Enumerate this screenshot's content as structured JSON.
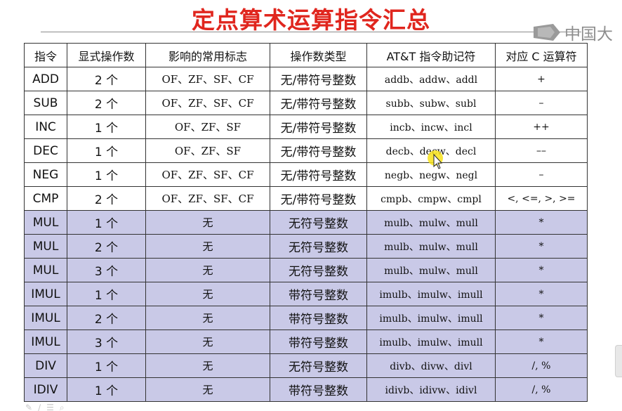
{
  "title": "定点算术运算指令汇总",
  "watermark": {
    "text": "中国大",
    "icon": "mooc-logo-icon"
  },
  "table": {
    "headers": [
      "指令",
      "显式操作数",
      "影响的常用标志",
      "操作数类型",
      "AT&T 指令助记符",
      "对应 C 运算符"
    ],
    "rows": [
      {
        "instr": "ADD",
        "operands": "2 个",
        "flags": "OF、ZF、SF、CF",
        "type": "无/带符号整数",
        "mnemonics": "addb、addw、addl",
        "c_op": "+",
        "group": "basic"
      },
      {
        "instr": "SUB",
        "operands": "2 个",
        "flags": "OF、ZF、SF、CF",
        "type": "无/带符号整数",
        "mnemonics": "subb、subw、subl",
        "c_op": "–",
        "group": "basic"
      },
      {
        "instr": "INC",
        "operands": "1 个",
        "flags": "OF、ZF、SF",
        "type": "无/带符号整数",
        "mnemonics": "incb、incw、incl",
        "c_op": "++",
        "group": "basic"
      },
      {
        "instr": "DEC",
        "operands": "1 个",
        "flags": "OF、ZF、SF",
        "type": "无/带符号整数",
        "mnemonics": "decb、decw、decl",
        "c_op": "––",
        "group": "basic"
      },
      {
        "instr": "NEG",
        "operands": "1 个",
        "flags": "OF、ZF、SF、CF",
        "type": "无/带符号整数",
        "mnemonics": "negb、negw、negl",
        "c_op": "–",
        "group": "basic"
      },
      {
        "instr": "CMP",
        "operands": "2 个",
        "flags": "OF、ZF、SF、CF",
        "type": "无/带符号整数",
        "mnemonics": "cmpb、cmpw、cmpl",
        "c_op": "<, <=, >, >=",
        "group": "basic"
      },
      {
        "instr": "MUL",
        "operands": "1 个",
        "flags": "无",
        "type": "无符号整数",
        "mnemonics": "mulb、mulw、mull",
        "c_op": "*",
        "group": "mul"
      },
      {
        "instr": "MUL",
        "operands": "2 个",
        "flags": "无",
        "type": "无符号整数",
        "mnemonics": "mulb、mulw、mull",
        "c_op": "*",
        "group": "mul"
      },
      {
        "instr": "MUL",
        "operands": "3 个",
        "flags": "无",
        "type": "无符号整数",
        "mnemonics": "mulb、mulw、mull",
        "c_op": "*",
        "group": "mul"
      },
      {
        "instr": "IMUL",
        "operands": "1 个",
        "flags": "无",
        "type": "带符号整数",
        "mnemonics": "imulb、imulw、imull",
        "c_op": "*",
        "group": "mul"
      },
      {
        "instr": "IMUL",
        "operands": "2 个",
        "flags": "无",
        "type": "带符号整数",
        "mnemonics": "imulb、imulw、imull",
        "c_op": "*",
        "group": "mul"
      },
      {
        "instr": "IMUL",
        "operands": "3 个",
        "flags": "无",
        "type": "带符号整数",
        "mnemonics": "imulb、imulw、imull",
        "c_op": "*",
        "group": "mul"
      },
      {
        "instr": "DIV",
        "operands": "1 个",
        "flags": "无",
        "type": "无符号整数",
        "mnemonics": "divb、divw、divl",
        "c_op": "/, %",
        "group": "mul"
      },
      {
        "instr": "IDIV",
        "operands": "1 个",
        "flags": "无",
        "type": "带符号整数",
        "mnemonics": "idivb、idivw、idivl",
        "c_op": "/, %",
        "group": "mul"
      }
    ]
  },
  "colors": {
    "title": "#e0261e",
    "mul_group_background": "#c9c9e7",
    "border": "#333333",
    "cursor_highlight": "#f7e21a"
  },
  "cursor": {
    "icon": "pointer-cursor-icon"
  }
}
